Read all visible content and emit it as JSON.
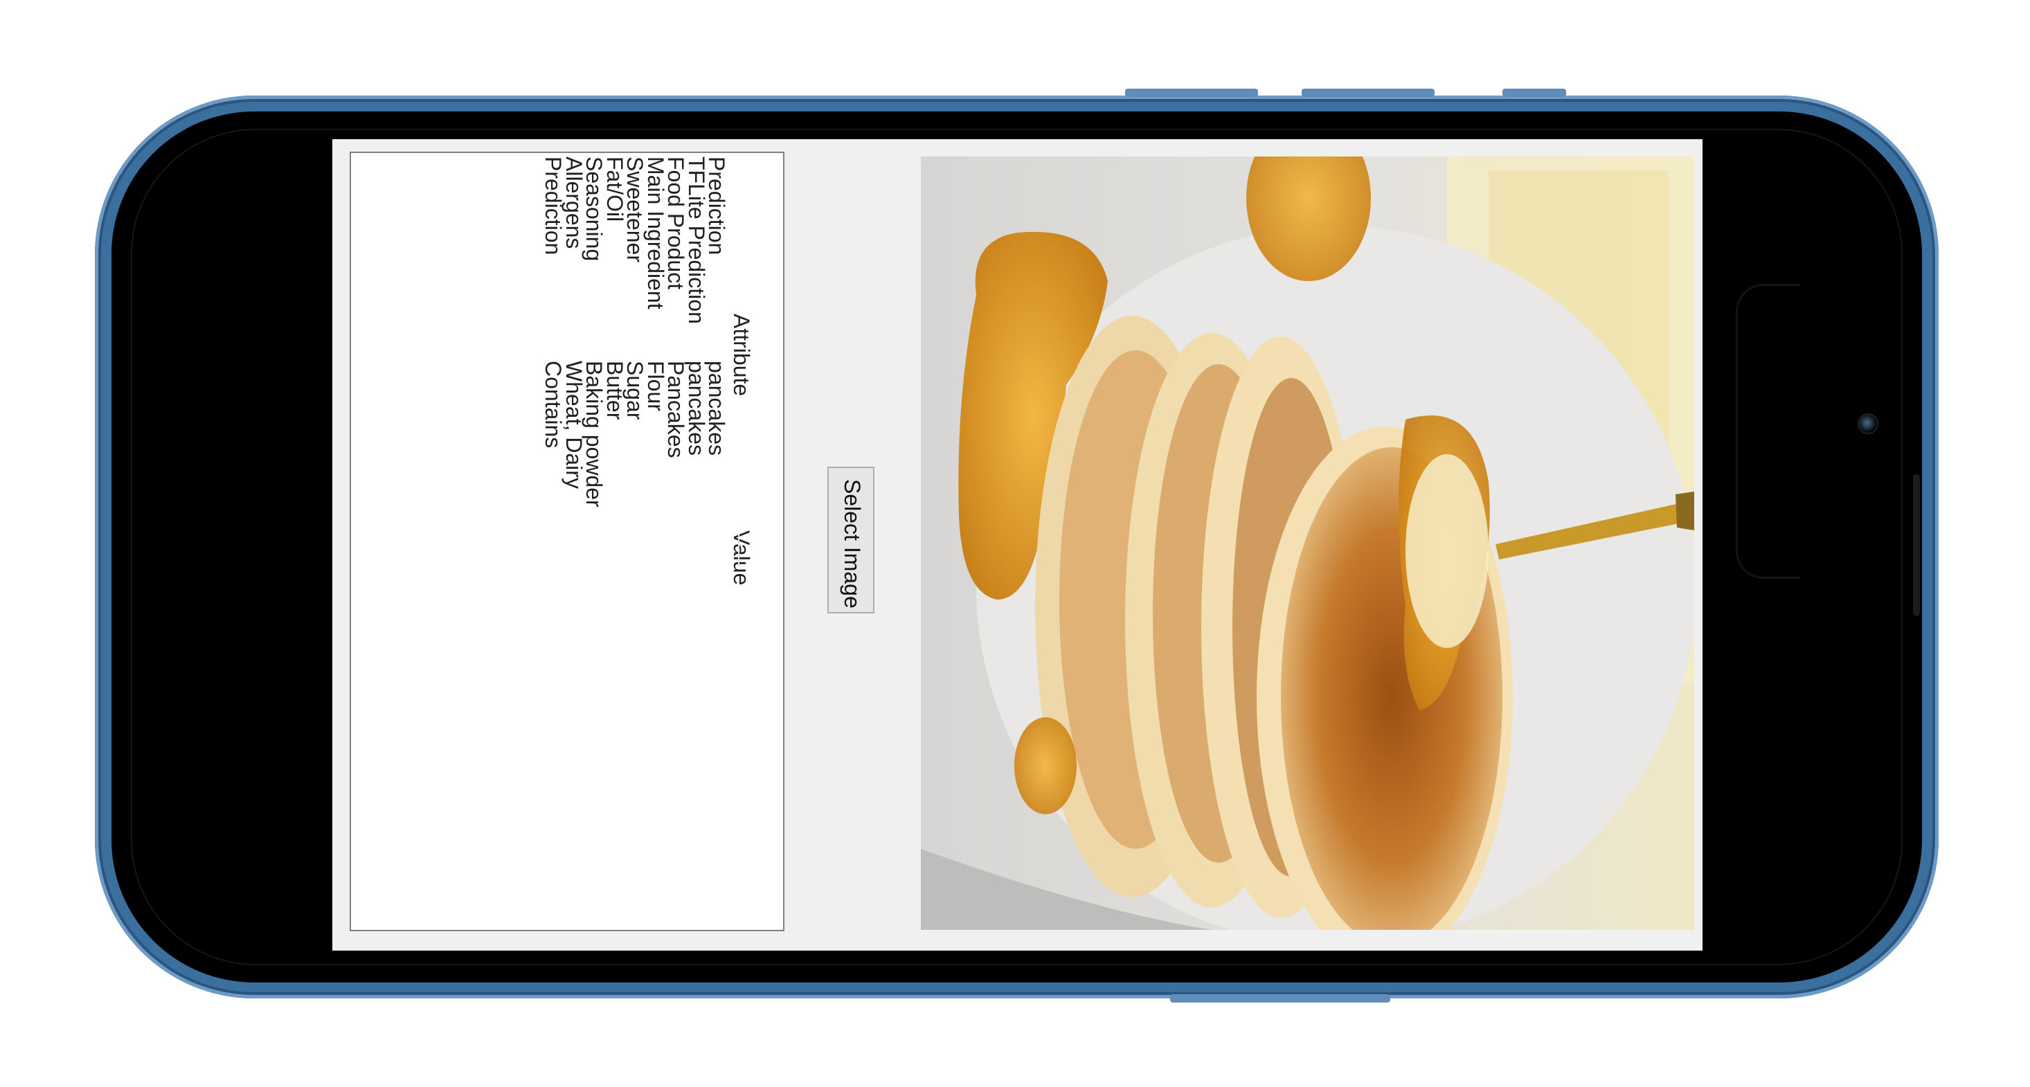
{
  "app": {
    "select_button_label": "Select Image",
    "table": {
      "headers": {
        "attribute": "Attribute",
        "value": "Value"
      },
      "rows": [
        {
          "attribute": "Prediction",
          "value": "pancakes"
        },
        {
          "attribute": "TFLite Prediction",
          "value": "pancakes"
        },
        {
          "attribute": "Food Product",
          "value": "Pancakes"
        },
        {
          "attribute": "Main Ingredient",
          "value": "Flour"
        },
        {
          "attribute": "Sweetener",
          "value": "Sugar"
        },
        {
          "attribute": "Fat/Oil",
          "value": "Butter"
        },
        {
          "attribute": "Seasoning",
          "value": "Baking powder"
        },
        {
          "attribute": "Allergens",
          "value": "Wheat, Dairy"
        },
        {
          "attribute": "Prediction",
          "value": "Contains"
        }
      ]
    },
    "image": {
      "subject": "stack of pancakes with syrup"
    }
  },
  "colors": {
    "frame": "#3b6f9e",
    "screen_bg": "#f0f0f0",
    "syrup": "#d9951a",
    "pancake": "#c27a2a"
  },
  "icons": [
    "camera-icon"
  ]
}
